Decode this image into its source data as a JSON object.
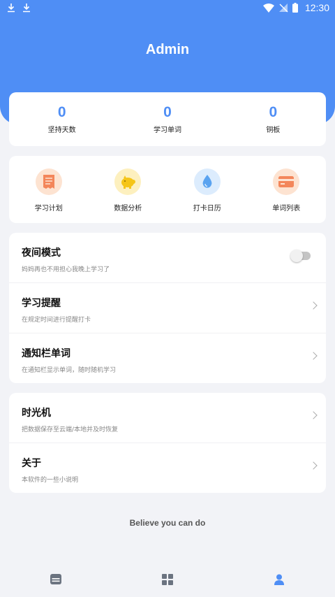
{
  "status_bar": {
    "time": "12:30"
  },
  "header": {
    "title": "Admin"
  },
  "stats": [
    {
      "value": "0",
      "label": "坚持天数"
    },
    {
      "value": "0",
      "label": "学习单词"
    },
    {
      "value": "0",
      "label": "铜板"
    }
  ],
  "features": [
    {
      "label": "学习计划",
      "icon": "receipt-icon",
      "bg": "#fde3d1",
      "color": "#f3865a"
    },
    {
      "label": "数据分析",
      "icon": "piggy-bank-icon",
      "bg": "#fdf0bf",
      "color": "#f5c518"
    },
    {
      "label": "打卡日历",
      "icon": "water-drop-icon",
      "bg": "#dcecfd",
      "color": "#5aa3f0"
    },
    {
      "label": "单词列表",
      "icon": "credit-card-icon",
      "bg": "#fde3d1",
      "color": "#f3865a"
    }
  ],
  "settings_group_1": [
    {
      "title": "夜间模式",
      "subtitle": "妈妈再也不用担心我晚上学习了",
      "control": "toggle",
      "checked": false
    },
    {
      "title": "学习提醒",
      "subtitle": "在规定时间进行提醒打卡",
      "control": "chevron"
    },
    {
      "title": "通知栏单词",
      "subtitle": "在通知栏显示单词，随时随机学习",
      "control": "chevron"
    }
  ],
  "settings_group_2": [
    {
      "title": "时光机",
      "subtitle": "把数据保存至云端/本地并及时恢复",
      "control": "chevron"
    },
    {
      "title": "关于",
      "subtitle": "本软件的一些小说明",
      "control": "chevron"
    }
  ],
  "slogan": "Believe you can do",
  "bottom_nav": [
    {
      "icon": "book-icon",
      "active": false
    },
    {
      "icon": "grid-icon",
      "active": false
    },
    {
      "icon": "person-icon",
      "active": true
    }
  ],
  "colors": {
    "primary": "#4f8ef5",
    "background": "#f2f3f7",
    "nav_inactive": "#6b7380"
  }
}
